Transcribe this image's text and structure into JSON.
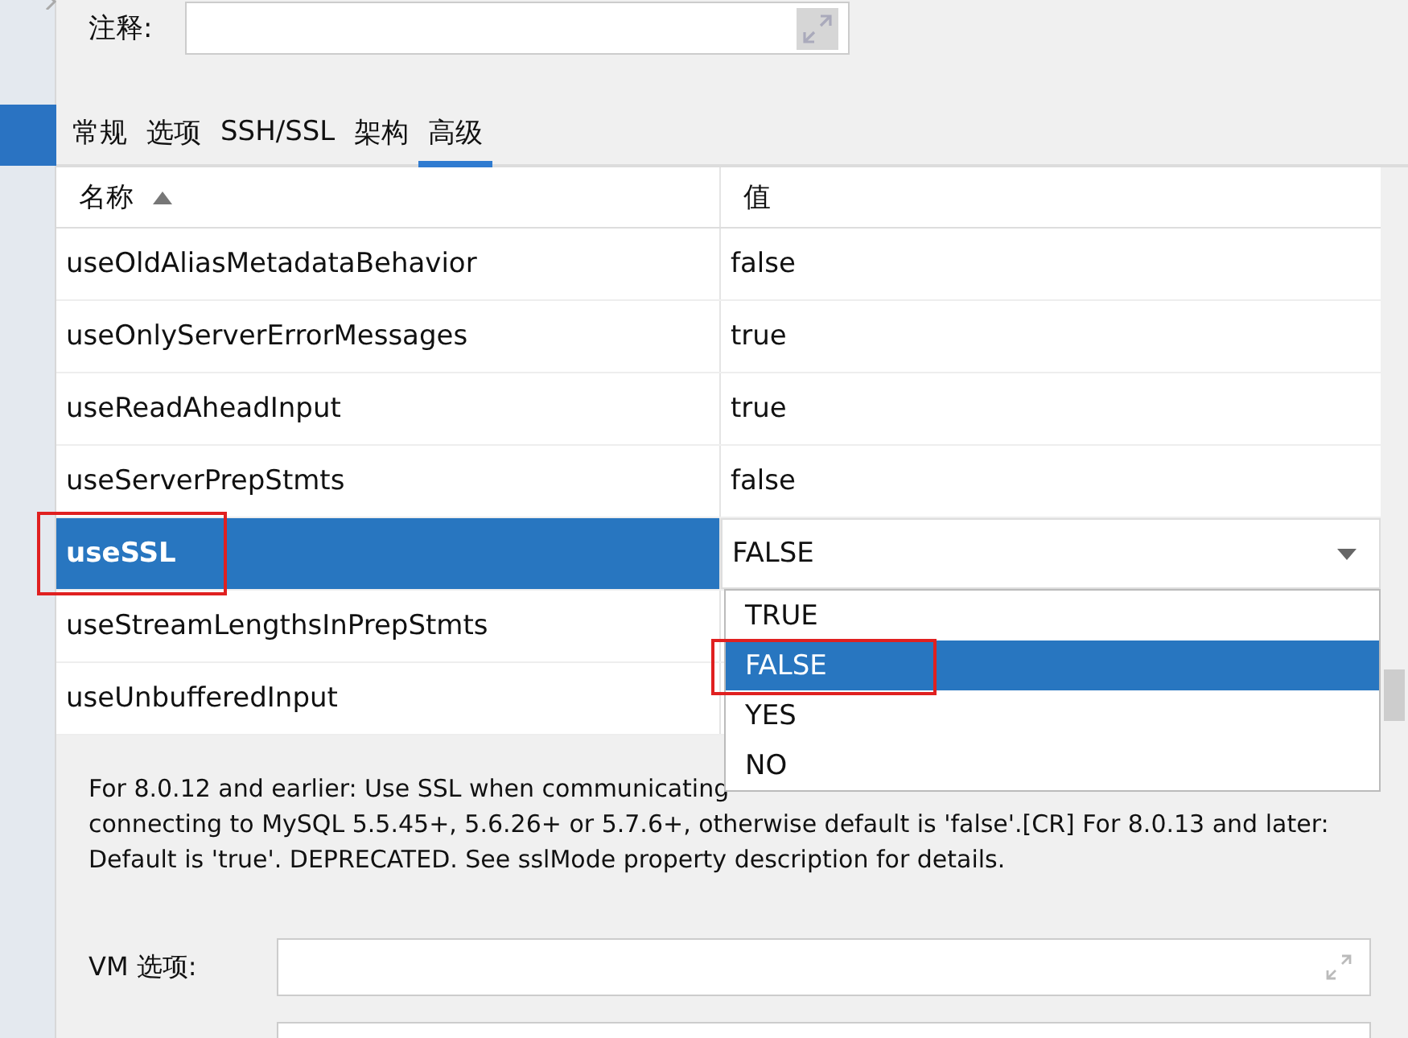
{
  "comment_field": {
    "label": "注释:"
  },
  "tabs": [
    {
      "label": "常规",
      "selected": false
    },
    {
      "label": "选项",
      "selected": false
    },
    {
      "label": "SSH/SSL",
      "selected": false
    },
    {
      "label": "架构",
      "selected": false
    },
    {
      "label": "高级",
      "selected": true
    }
  ],
  "table": {
    "columns": [
      {
        "label": "名称",
        "sorted": true
      },
      {
        "label": "值",
        "sorted": false
      }
    ],
    "rows": [
      {
        "name": "useOldAliasMetadataBehavior",
        "value": "false",
        "selected": false,
        "highlighted": false
      },
      {
        "name": "useOnlyServerErrorMessages",
        "value": "true",
        "selected": false,
        "highlighted": false
      },
      {
        "name": "useReadAheadInput",
        "value": "true",
        "selected": false,
        "highlighted": false
      },
      {
        "name": "useServerPrepStmts",
        "value": "false",
        "selected": false,
        "highlighted": false
      },
      {
        "name": "useSSL",
        "value": "FALSE",
        "selected": true,
        "highlighted": true
      },
      {
        "name": "useStreamLengthsInPrepStmts",
        "selected": false,
        "highlighted": false
      },
      {
        "name": "useUnbufferedInput",
        "selected": false,
        "highlighted": false
      }
    ]
  },
  "dropdown": {
    "options": [
      {
        "label": "TRUE",
        "selected": false,
        "highlighted": false
      },
      {
        "label": "FALSE",
        "selected": true,
        "highlighted": true
      },
      {
        "label": "YES",
        "selected": false,
        "highlighted": false
      },
      {
        "label": "NO",
        "selected": false,
        "highlighted": false
      }
    ]
  },
  "description": [
    "For 8.0.12 and earlier: Use SSL when communicating",
    "connecting to MySQL 5.5.45+, 5.6.26+ or 5.7.6+, otherwise default is 'false'.[CR] For 8.0.13 and later:",
    "Default is 'true'. DEPRECATED. See sslMode property description for details."
  ],
  "vm_options": {
    "label": "VM 选项:"
  }
}
